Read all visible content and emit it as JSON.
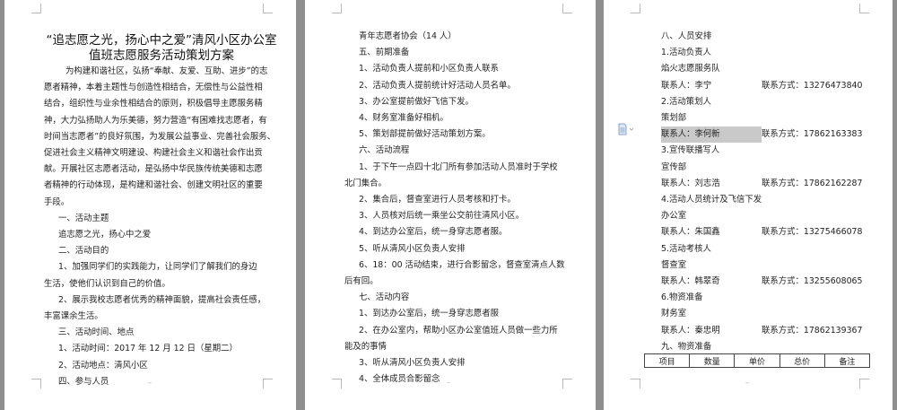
{
  "page1": {
    "title_line1": "“追志愿之光，扬心中之爱”清风小区办公室",
    "title_line2": "值班志愿服务活动策划方案",
    "intro_lines": [
      "为构建和谐社区，弘扬“奉献、友爱、互助、进步”的志",
      "愿者精神，本着主题性与创造性相结合，无偿性与公益性相",
      "结合，组织性与业余性相结合的原则，积极倡导主愿服务精",
      "神，大力弘扬助人为乐美德，努力营造“有困难找志愿者，有",
      "时间当志愿者”的良好氛围，为发展公益事业、完善社会服务、",
      "促进社会主义精神文明建设、构建社会主义和谐社会作出贡",
      "献。开展社区志愿者活动，是弘扬中华民族传统美德和志愿",
      "者精神的行动体现，是构建和谐社会、创建文明社区的重要",
      "手段。"
    ],
    "lines": [
      {
        "text": "一、活动主题",
        "indent": 1
      },
      {
        "text": "追志愿之光，扬心中之爱",
        "indent": 1
      },
      {
        "text": "二、活动目的",
        "indent": 1
      },
      {
        "text": "1、加强同学们的实践能力，让同学们了解我们的身边",
        "indent": 1
      },
      {
        "text": "生活，使他们认识到自己的价值。",
        "indent": 0
      },
      {
        "text": "2、展示我校志愿者优秀的精神面貌，提高社会责任感，",
        "indent": 1
      },
      {
        "text": "丰富课余生活。",
        "indent": 0
      },
      {
        "text": "三、活动时间、地点",
        "indent": 1
      },
      {
        "text": "1、活动时间：2017 年 12 月 12 日（星期二）",
        "indent": 1
      },
      {
        "text": "2、活动地点：清风小区",
        "indent": 1
      },
      {
        "text": "四、参与人员",
        "indent": 1
      }
    ]
  },
  "page2": {
    "lines": [
      {
        "text": "青年志愿者协会（14 人）",
        "indent": 1
      },
      {
        "text": "五、前期准备",
        "indent": 1
      },
      {
        "text": "1、活动负责人提前和小区负责人联系",
        "indent": 1
      },
      {
        "text": "2、活动负责人提前统计好活动人员名单。",
        "indent": 1
      },
      {
        "text": "3、办公室提前做好飞信下发。",
        "indent": 1
      },
      {
        "text": "4、财务室准备好相机。",
        "indent": 1
      },
      {
        "text": "5、策划部提前做好活动策划方案。",
        "indent": 1
      },
      {
        "text": "六、活动流程",
        "indent": 1
      },
      {
        "text": "1、于下午一点四十北门所有参加活动人员准时于学校",
        "indent": 1
      },
      {
        "text": "北门集合。",
        "indent": 0
      },
      {
        "text": "2、集合后，督查室进行人员考核和打卡。",
        "indent": 1
      },
      {
        "text": "3、人员核对后统一乘坐公交前往清风小区。",
        "indent": 1
      },
      {
        "text": "4、到达办公室后，统一身穿志愿者服。",
        "indent": 1
      },
      {
        "text": "5、听从清风小区负责人安排",
        "indent": 1
      },
      {
        "text": "6、18：00 活动结束，进行合影留念，督查室清点人数",
        "indent": 1
      },
      {
        "text": "后有回。",
        "indent": 0
      },
      {
        "text": "七、活动内容",
        "indent": 1
      },
      {
        "text": "1、到达办公室后，统一身穿志愿者服",
        "indent": 1
      },
      {
        "text": "2、在办公室内，帮助小区办公室值班人员做一些力所",
        "indent": 1
      },
      {
        "text": "能及的事情",
        "indent": 0
      },
      {
        "text": "3、听从清风小区负责人安排",
        "indent": 1
      },
      {
        "text": "4、全体成员合影留念",
        "indent": 1
      }
    ]
  },
  "page3": {
    "heading": "八、人员安排",
    "groups": [
      {
        "role": "1.活动负责人",
        "dept": "焰火志愿服务队",
        "contact_label": "联系人：李宁",
        "phone_label": "联系方式：13276473840"
      },
      {
        "role": "2.活动策划人",
        "dept": "策划部",
        "contact_label": "联系人：李何新",
        "phone_label": "联系方式：17862163383"
      },
      {
        "role": "3.宣传联播写人",
        "dept": "宣传部",
        "contact_label": "联系人：刘志浩",
        "phone_label": "联系方式：17862162287"
      },
      {
        "role": "4.活动人员统计及飞信下发",
        "dept": "办公室",
        "contact_label": "联系人：朱国鑫",
        "phone_label": "联系方式：13275466078"
      },
      {
        "role": "5.活动考核人",
        "dept": "督查室",
        "contact_label": "联系人：韩翠奇",
        "phone_label": "联系方式：13255608065"
      },
      {
        "role": "6.物资准备",
        "dept": "财务室",
        "contact_label": "联系人：秦忠明",
        "phone_label": "联系方式：17862139367"
      }
    ],
    "supplies_heading": "九、物资准备",
    "table_headers": [
      "项目",
      "数量",
      "单价",
      "总价",
      "备注"
    ]
  }
}
